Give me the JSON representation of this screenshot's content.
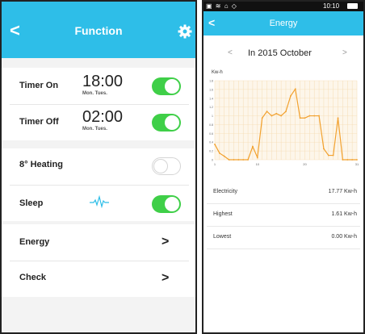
{
  "function_screen": {
    "back_icon": "chevron-left-icon",
    "title": "Function",
    "settings_icon": "gear-icon",
    "timer_on": {
      "label": "Timer On",
      "time": "18:00",
      "days": "Mon. Tues.",
      "enabled": true
    },
    "timer_off": {
      "label": "Timer Off",
      "time": "02:00",
      "days": "Mon. Tues.",
      "enabled": true
    },
    "heating": {
      "label": "8° Heating",
      "enabled": false
    },
    "sleep": {
      "label": "Sleep",
      "icon": "sleep-wave-icon",
      "enabled": true
    },
    "energy": {
      "label": "Energy",
      "icon": "chevron-right-icon"
    },
    "check": {
      "label": "Check",
      "icon": "chevron-right-icon"
    },
    "colors": {
      "header": "#2ebee8",
      "toggle_on": "#3fcf48",
      "background": "#f3f3f3"
    }
  },
  "energy_screen": {
    "status_bar": {
      "icons": "▣ ≋ ⌂ ◇",
      "time": "10:10"
    },
    "back_icon": "chevron-left-icon",
    "title": "Energy",
    "prev_icon": "chevron-left-icon",
    "next_icon": "chevron-right-icon",
    "month_label": "In 2015  October",
    "unit_label": "Kw-h",
    "chart_data": {
      "type": "line",
      "title": "",
      "xlabel": "",
      "ylabel": "Kw-h",
      "x": [
        1,
        2,
        3,
        4,
        5,
        6,
        7,
        8,
        9,
        10,
        11,
        12,
        13,
        14,
        15,
        16,
        17,
        18,
        19,
        20,
        21,
        22,
        23,
        24,
        25,
        26,
        27,
        28,
        29,
        30,
        31
      ],
      "values": [
        0.35,
        0.15,
        0.08,
        0.0,
        0.0,
        0.0,
        0.0,
        0.0,
        0.3,
        0.05,
        0.95,
        1.1,
        1.0,
        1.05,
        1.0,
        1.1,
        1.45,
        1.61,
        0.95,
        0.95,
        1.0,
        1.0,
        1.0,
        0.25,
        0.1,
        0.1,
        0.95,
        0.0,
        0.0,
        0.0,
        0.0
      ],
      "ylim": [
        0,
        1.8
      ],
      "yticks": [
        "1.8",
        "1.6",
        "1.4",
        "1.2",
        "1",
        "0.8",
        "0.6",
        "0.4",
        "0.2",
        "0"
      ],
      "xticks": [
        "1",
        "10",
        "20",
        "31"
      ],
      "line_color": "#f2a12e",
      "grid": true
    },
    "stats": [
      {
        "label": "Electricity",
        "value": "17.77 Kw-h"
      },
      {
        "label": "Highest",
        "value": "1.61 Kw-h"
      },
      {
        "label": "Lowest",
        "value": "0.00 Kw-h"
      }
    ]
  }
}
